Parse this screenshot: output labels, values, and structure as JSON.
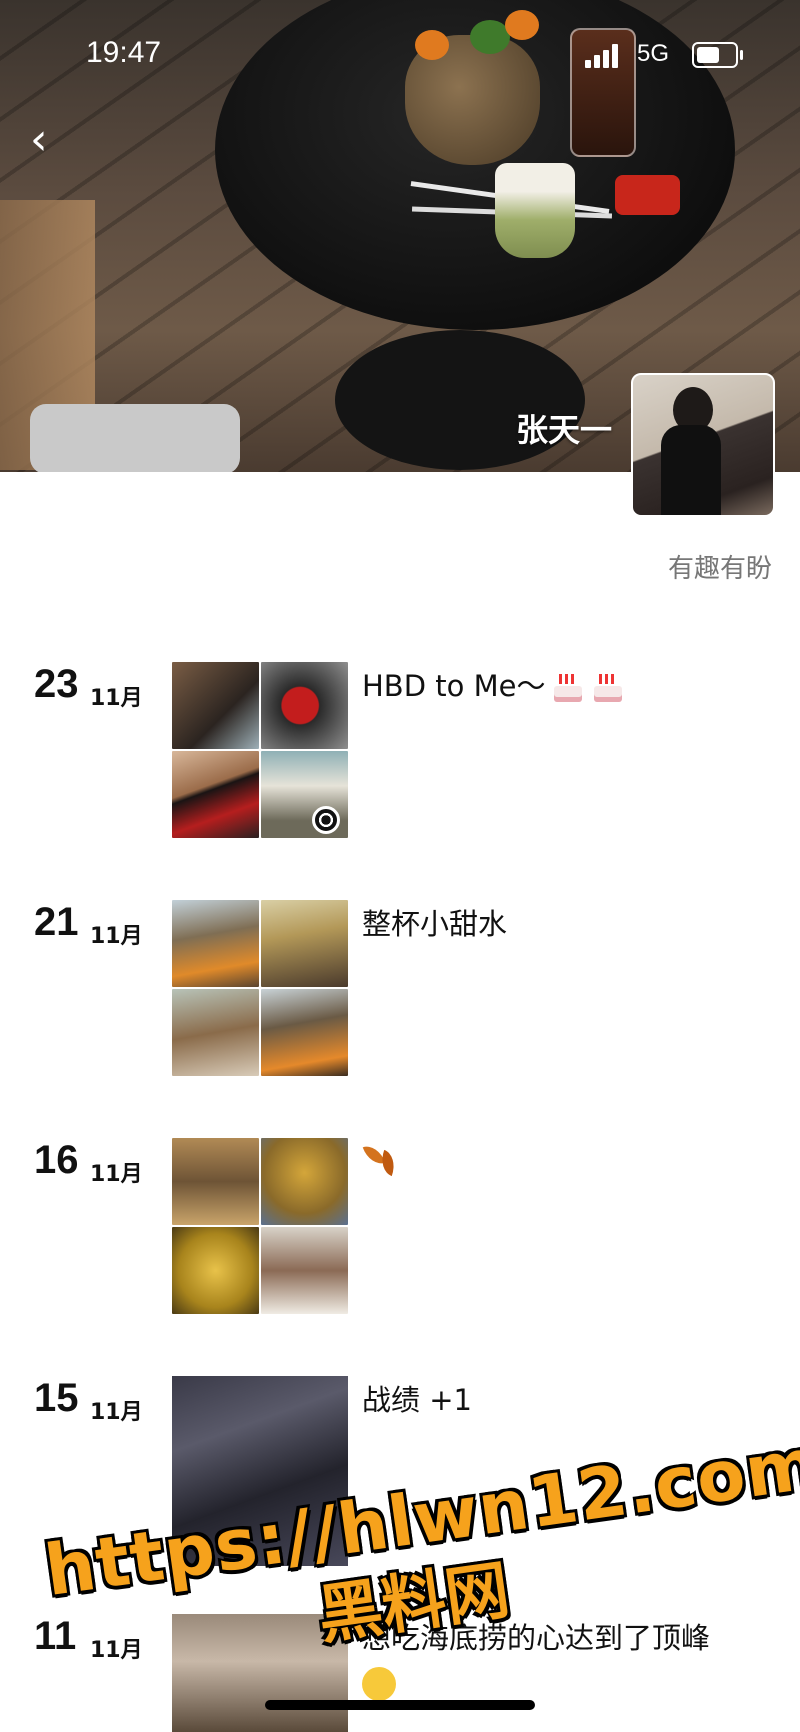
{
  "status_bar": {
    "time": "19:47",
    "network": "5G"
  },
  "profile": {
    "nickname": "张天一",
    "signature": "有趣有盼"
  },
  "feed": [
    {
      "day": "23",
      "month": "11月",
      "caption": "HBD to Me～"
    },
    {
      "day": "21",
      "month": "11月",
      "caption": "整杯小甜水"
    },
    {
      "day": "16",
      "month": "11月",
      "caption": ""
    },
    {
      "day": "15",
      "month": "11月",
      "caption": "战绩 +1"
    },
    {
      "day": "11",
      "month": "11月",
      "caption": "想吃海底捞的心达到了顶峰"
    }
  ],
  "watermark": {
    "url": "https://hlwn12.com",
    "site": "黑料网"
  },
  "icons": [
    "back-arrow-icon",
    "signal-icon",
    "battery-icon",
    "cake-emoji-icon",
    "leaf-emoji-icon",
    "smile-emoji-icon"
  ]
}
